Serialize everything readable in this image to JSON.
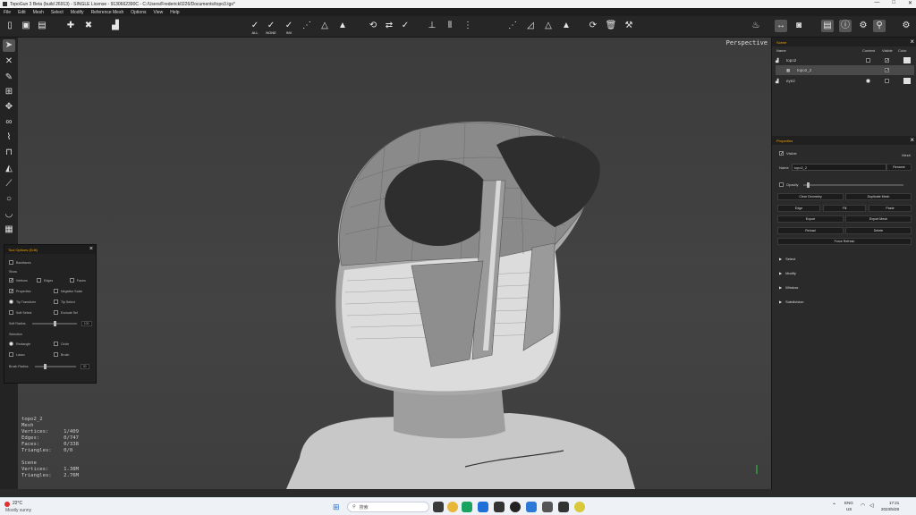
{
  "window": {
    "title": "TopoGun 3 Beta (build 26913) - SINGLE License - 9130662390C - C:/Users/Frederick0226/Documents/topo3.tgs*",
    "controls": [
      "—",
      "□",
      "✕"
    ]
  },
  "menu": [
    "File",
    "Edit",
    "Mesh",
    "Select",
    "Modify",
    "Reference Mesh",
    "Options",
    "View",
    "Help"
  ],
  "toolbar": {
    "select_labels": [
      "ALL",
      "NONE",
      "INV"
    ]
  },
  "viewport": {
    "label": "Perspective",
    "stats": {
      "object": "topo2_2",
      "type": "Mesh",
      "vertices_label": "Vertices:",
      "vertices": "1/409",
      "edges_label": "Edges:",
      "edges": "0/747",
      "faces_label": "Faces:",
      "faces": "0/338",
      "triangles_label": "Triangles:",
      "triangles": "0/0",
      "scene": "Scene",
      "scene_vertices": "1.38M",
      "scene_triangles": "2.76M"
    }
  },
  "tool_options": {
    "title": "Tool Options (Edit)",
    "backfaces": "Backfaces",
    "show_title": "Show",
    "vertices": "Vertices",
    "edges": "Edges",
    "faces": "Faces",
    "properties": "Properties",
    "negative_scale": "Negative Scale",
    "tip_transform": "Tip Transform",
    "tip_select": "Tip Select",
    "soft_select": "Soft Select",
    "exclude_sel": "Exclude Sel",
    "soft_radius": "Soft Radius",
    "soft_radius_val": "100",
    "selection_title": "Selection",
    "rectangle": "Rectangle",
    "circle": "Circle",
    "lasso": "Lasso",
    "brush": "Brush",
    "brush_radius": "Brush Radius",
    "brush_radius_val": "30"
  },
  "scene_panel": {
    "title": "Scene",
    "headers": [
      "Name",
      "Content",
      "Visible",
      "Color"
    ],
    "items": [
      {
        "name": "topo2"
      },
      {
        "name": "topo2_2"
      },
      {
        "name": "eye2"
      }
    ]
  },
  "properties_panel": {
    "title": "Properties",
    "visible_label": "Visible",
    "mesh_label": "Mesh",
    "name_label": "Name",
    "name_value": "topo2_2",
    "rename": "Rename",
    "opacity_label": "Opacity",
    "buttons": [
      "Clear Geometry",
      "Duplicate Mesh",
      "Edge",
      "Fill",
      "Paste",
      "Export",
      "Export Mesh",
      "Reload",
      "Delete",
      "Force Refresh"
    ],
    "sections": [
      "Select",
      "Modify",
      "Window",
      "Subdivision"
    ]
  },
  "taskbar": {
    "weather_temp": "22°C",
    "weather_desc": "Mostly sunny",
    "search_placeholder": "搜索",
    "lang1": "ENG",
    "lang2": "US",
    "time": "17:21",
    "date": "2023/5/28"
  },
  "colors": {
    "accent": "#f0a000",
    "panel_bg": "#2a2a2a",
    "viewport_bg": "#404040",
    "taskbar_bg": "#eef1f6"
  }
}
